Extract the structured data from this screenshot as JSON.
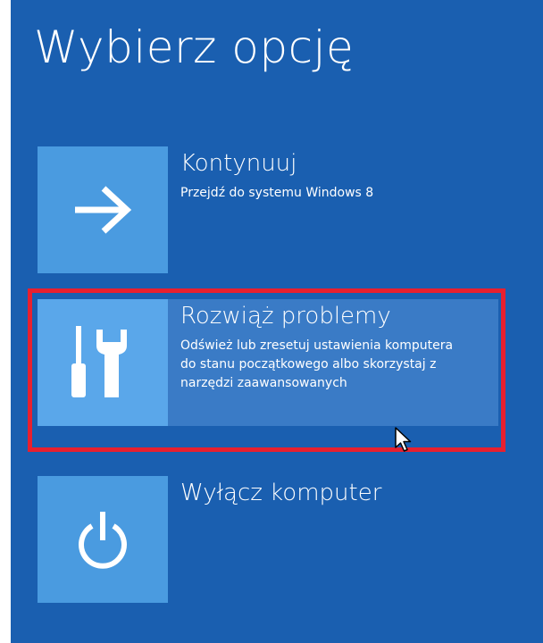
{
  "page": {
    "title": "Wybierz opcję"
  },
  "options": [
    {
      "title": "Kontynuuj",
      "description": "Przejdź do systemu Windows 8",
      "icon": "arrow-right-icon"
    },
    {
      "title": "Rozwiąż problemy",
      "description": "Odśwież lub zresetuj ustawienia komputera do stanu początkowego albo skorzystaj z narzędzi zaawansowanych",
      "icon": "tools-icon"
    },
    {
      "title": "Wyłącz komputer",
      "description": "",
      "icon": "power-icon"
    }
  ],
  "colors": {
    "background": "#1a5fb0",
    "tile": "#4a9be0",
    "selected_row": "#3a7bc6",
    "highlight_frame": "#e8202f"
  }
}
